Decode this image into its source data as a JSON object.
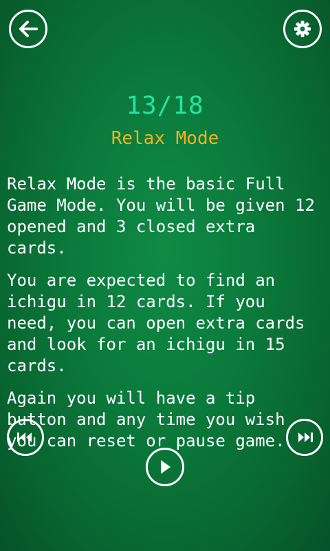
{
  "header": {
    "back_icon": "arrow-left-icon",
    "settings_icon": "gear-icon"
  },
  "tutorial": {
    "progress": "13/18",
    "title": "Relax Mode",
    "paragraphs": [
      "Relax Mode is the basic Full Game Mode. You will be given 12 opened and 3 closed extra cards.",
      "You are expected to find an ichigu in 12 cards. If you need, you can open extra cards and look for an ichigu in 15 cards.",
      "Again you will have a tip button and any time you wish you can reset or pause game."
    ]
  },
  "controls": {
    "prev_icon": "skip-previous-icon",
    "next_icon": "skip-next-icon",
    "play_icon": "play-icon"
  },
  "colors": {
    "background": "#0b7a3c",
    "progress": "#22e6a4",
    "title": "#f2b21c",
    "text": "#ffffff"
  }
}
